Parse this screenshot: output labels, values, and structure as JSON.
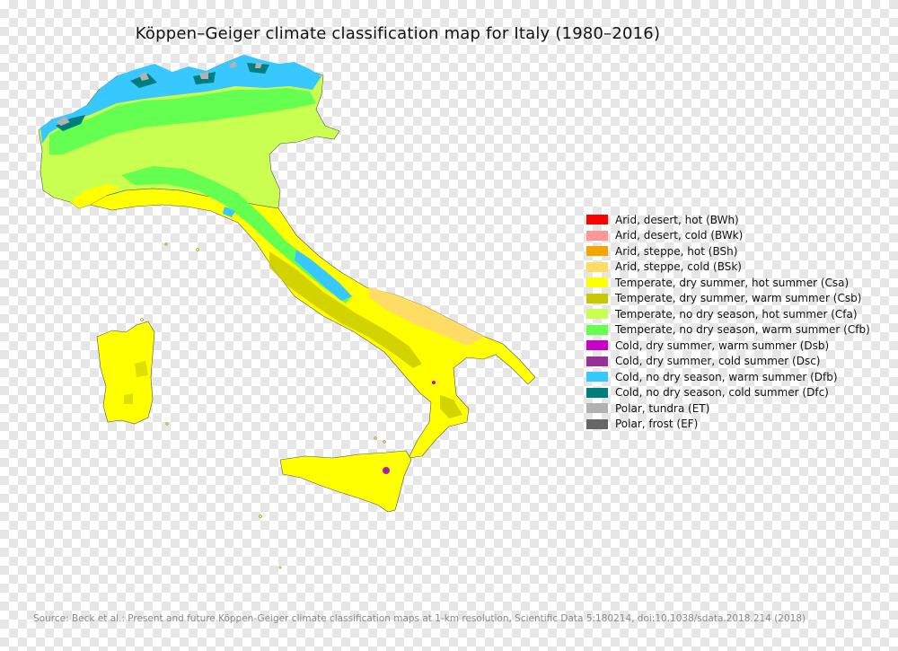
{
  "title": "Köppen–Geiger climate classification map for Italy (1980–2016)",
  "source": "Source: Beck et al.: Present and future Köppen-Geiger climate classification maps at 1-km resolution, Scientific Data 5:180214, doi:10.1038/sdata.2018.214 (2018)",
  "legend": [
    {
      "label": "Arid, desert, hot (BWh)",
      "color": "#ff0000"
    },
    {
      "label": "Arid, desert, cold (BWk)",
      "color": "#ff9696"
    },
    {
      "label": "Arid, steppe, hot (BSh)",
      "color": "#f5a500"
    },
    {
      "label": "Arid, steppe, cold (BSk)",
      "color": "#ffdc64"
    },
    {
      "label": "Temperate, dry summer, hot summer (Csa)",
      "color": "#ffff00"
    },
    {
      "label": "Temperate, dry summer, warm summer (Csb)",
      "color": "#c8c800"
    },
    {
      "label": "Temperate, no dry season, hot summer (Cfa)",
      "color": "#c8ff50"
    },
    {
      "label": "Temperate, no dry season, warm summer (Cfb)",
      "color": "#64ff50"
    },
    {
      "label": "Cold, dry summer, warm summer (Dsb)",
      "color": "#c800c8"
    },
    {
      "label": "Cold, dry summer, cold summer (Dsc)",
      "color": "#963296"
    },
    {
      "label": "Cold, no dry season, warm summer (Dfb)",
      "color": "#37c8ff"
    },
    {
      "label": "Cold, no dry season, cold summer (Dfc)",
      "color": "#007d7d"
    },
    {
      "label": "Polar, tundra (ET)",
      "color": "#b2b2b2"
    },
    {
      "label": "Polar, frost (EF)",
      "color": "#666666"
    }
  ]
}
